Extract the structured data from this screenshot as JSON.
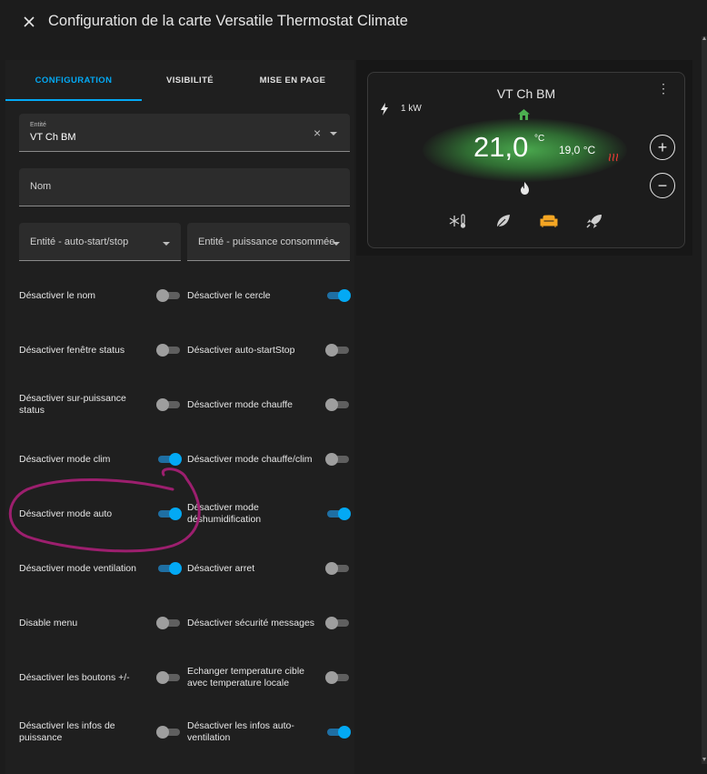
{
  "dialog": {
    "title": "Configuration de la carte Versatile Thermostat Climate"
  },
  "tabs": [
    {
      "label": "CONFIGURATION",
      "active": true
    },
    {
      "label": "VISIBILITÉ",
      "active": false
    },
    {
      "label": "MISE EN PAGE",
      "active": false
    }
  ],
  "form": {
    "entity": {
      "label": "Entité",
      "value": "VT Ch BM"
    },
    "name": {
      "placeholder": "Nom"
    },
    "auto_start_stop": {
      "placeholder": "Entité - auto-start/stop"
    },
    "power_consumed": {
      "placeholder": "Entité - puissance consommée"
    }
  },
  "toggles_left": [
    {
      "label": "Désactiver le nom",
      "on": false
    },
    {
      "label": "Désactiver fenêtre status",
      "on": false
    },
    {
      "label": "Désactiver sur-puissance status",
      "on": false
    },
    {
      "label": "Désactiver mode clim",
      "on": true
    },
    {
      "label": "Désactiver mode auto",
      "on": true
    },
    {
      "label": "Désactiver mode ventilation",
      "on": true
    },
    {
      "label": "Disable menu",
      "on": false
    },
    {
      "label": "Désactiver les boutons +/-",
      "on": false
    },
    {
      "label": "Désactiver les infos de puissance",
      "on": false
    }
  ],
  "toggles_right": [
    {
      "label": "Désactiver le cercle",
      "on": true
    },
    {
      "label": "Désactiver auto-startStop",
      "on": false
    },
    {
      "label": "Désactiver mode chauffe",
      "on": false
    },
    {
      "label": "Désactiver mode chauffe/clim",
      "on": false
    },
    {
      "label": "Désactiver mode déshumidification",
      "on": true
    },
    {
      "label": "Désactiver arret",
      "on": false
    },
    {
      "label": "Désactiver sécurité messages",
      "on": false
    },
    {
      "label": "Echanger temperature cible avec temperature locale",
      "on": false
    },
    {
      "label": "Désactiver les infos auto-ventilation",
      "on": true
    }
  ],
  "preview": {
    "title": "VT Ch BM",
    "power": "1 kW",
    "target_temp": "21,0",
    "target_unit": "°C",
    "current_temp": "19,0 °C",
    "plus": "+",
    "minus": "−",
    "menu": "⋮"
  },
  "colors": {
    "accent": "#03a9f4",
    "glow": "#4caf50",
    "active_mode": "#f5a623",
    "annotation": "#9c1f6e"
  },
  "icons": {
    "close": "close-icon",
    "power": "lightning-icon",
    "home": "home-icon",
    "heat": "heat-waves-icon",
    "flame": "flame-icon",
    "frost": "snowflake-thermometer-icon",
    "eco": "leaf-icon",
    "comfort": "sofa-icon",
    "boost": "rocket-icon"
  }
}
